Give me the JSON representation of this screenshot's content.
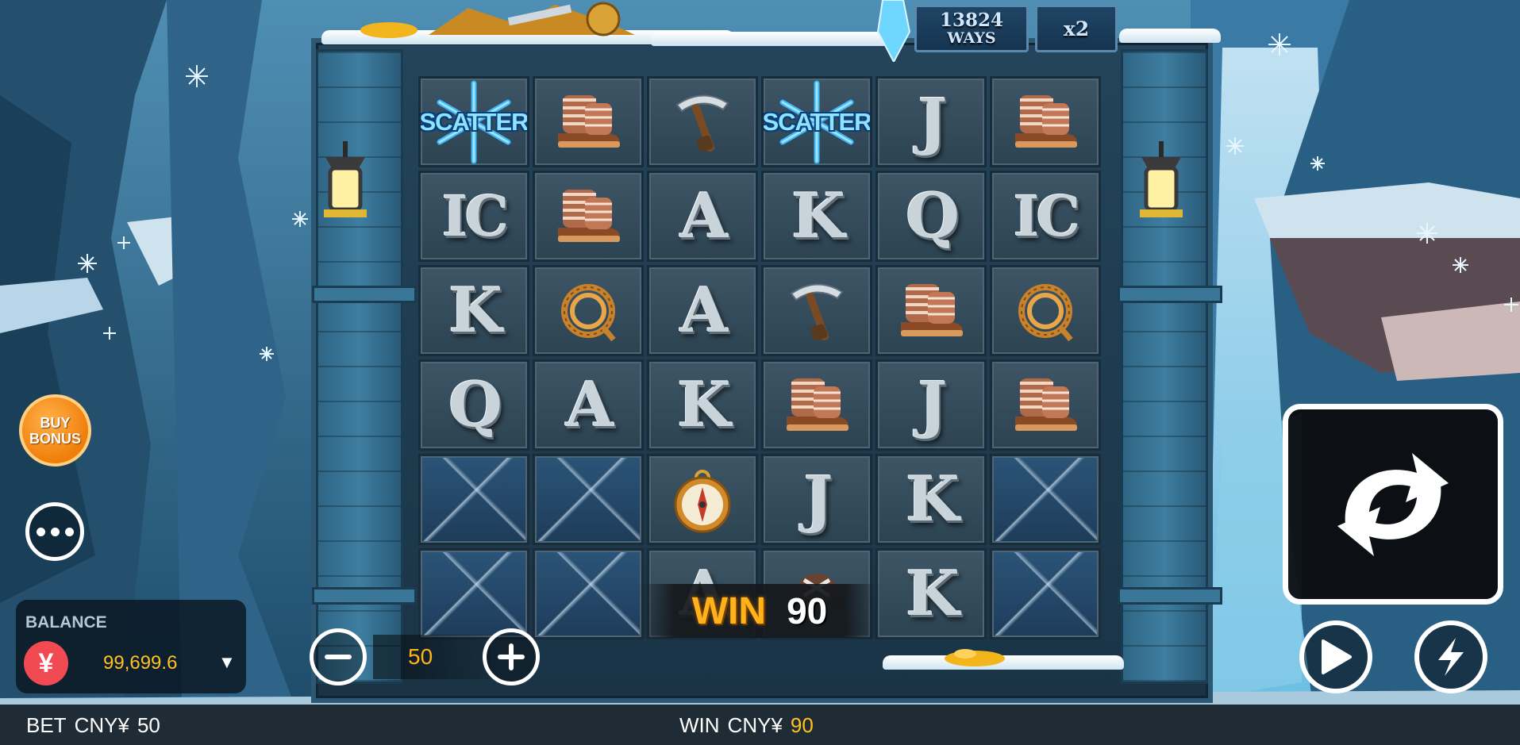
{
  "header": {
    "ways_value": "13824",
    "ways_label": "WAYS",
    "multiplier": "x2"
  },
  "reels": {
    "rows": [
      [
        {
          "kind": "scatter",
          "text": "SCATTER"
        },
        {
          "kind": "boots"
        },
        {
          "kind": "pickaxe"
        },
        {
          "kind": "scatter",
          "text": "SCATTER"
        },
        {
          "kind": "letter",
          "text": "J"
        },
        {
          "kind": "boots"
        }
      ],
      [
        {
          "kind": "letter",
          "text": "IC"
        },
        {
          "kind": "boots"
        },
        {
          "kind": "letter",
          "text": "A"
        },
        {
          "kind": "letter",
          "text": "K"
        },
        {
          "kind": "letter",
          "text": "Q"
        },
        {
          "kind": "letter",
          "text": "IC"
        }
      ],
      [
        {
          "kind": "letter",
          "text": "K"
        },
        {
          "kind": "rope"
        },
        {
          "kind": "letter",
          "text": "A"
        },
        {
          "kind": "pickaxe"
        },
        {
          "kind": "boots"
        },
        {
          "kind": "rope"
        }
      ],
      [
        {
          "kind": "letter",
          "text": "Q"
        },
        {
          "kind": "letter",
          "text": "A"
        },
        {
          "kind": "letter",
          "text": "K"
        },
        {
          "kind": "boots"
        },
        {
          "kind": "letter",
          "text": "J"
        },
        {
          "kind": "boots"
        }
      ],
      [
        {
          "kind": "ice"
        },
        {
          "kind": "ice"
        },
        {
          "kind": "compass"
        },
        {
          "kind": "letter",
          "text": "J"
        },
        {
          "kind": "letter",
          "text": "K"
        },
        {
          "kind": "ice"
        }
      ],
      [
        {
          "kind": "ice"
        },
        {
          "kind": "ice"
        },
        {
          "kind": "letter",
          "text": "A"
        },
        {
          "kind": "hat"
        },
        {
          "kind": "letter",
          "text": "K"
        },
        {
          "kind": "ice"
        }
      ]
    ]
  },
  "win_banner": {
    "label": "WIN",
    "amount": "90"
  },
  "buy_bonus": {
    "line1": "BUY",
    "line2": "BONUS"
  },
  "balance": {
    "label": "BALANCE",
    "currency_symbol": "¥",
    "value": "99,699.6",
    "dropdown": "▼"
  },
  "bet_stepper": {
    "value": "50"
  },
  "status_bar": {
    "bet_label": "BET",
    "bet_currency": "CNY¥",
    "bet_value": "50",
    "win_label": "WIN",
    "win_currency": "CNY¥",
    "win_value": "90"
  },
  "icons": {
    "spin": "spin-arrows-icon",
    "autoplay": "play-icon",
    "turbo": "lightning-icon",
    "menu": "more-dots-icon",
    "minus": "minus-icon",
    "plus": "plus-icon",
    "currency": "yen-icon"
  },
  "colors": {
    "accent_gold": "#ffc21e",
    "win_orange": "#ffb21a",
    "buy_bonus_orange": "#f07e0a",
    "currency_red": "#f24a52"
  }
}
